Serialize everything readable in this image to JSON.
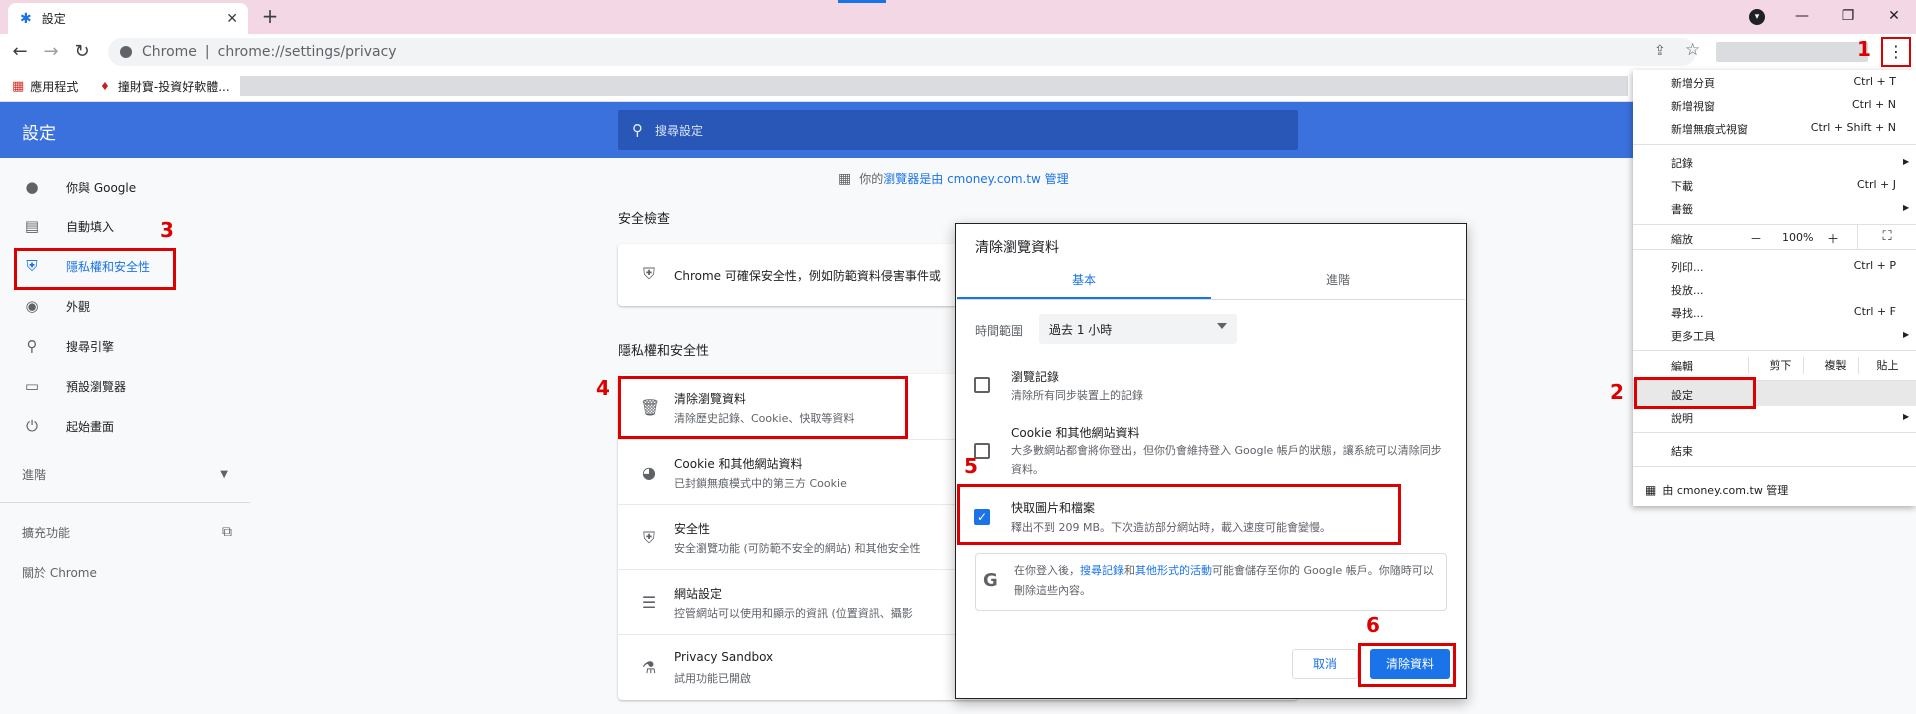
{
  "tab": {
    "title": "設定",
    "icon": "gear-icon",
    "close": "✕",
    "new_tab": "+"
  },
  "window": {
    "minimize": "—",
    "restore": "❐",
    "close": "✕"
  },
  "omnibox": {
    "scheme": "Chrome",
    "separator": "|",
    "url": "chrome://settings/privacy"
  },
  "bookmarks": {
    "apps": "應用程式",
    "site": "撞財寶-投資好軟體..."
  },
  "header": {
    "title": "設定",
    "search_placeholder": "搜尋設定"
  },
  "sidebar": {
    "items": [
      {
        "label": "你與 Google",
        "icon": "person-icon"
      },
      {
        "label": "自動填入",
        "icon": "clipboard-icon"
      },
      {
        "label": "隱私權和安全性",
        "icon": "shield-icon"
      },
      {
        "label": "外觀",
        "icon": "palette-icon"
      },
      {
        "label": "搜尋引擎",
        "icon": "search-icon"
      },
      {
        "label": "預設瀏覽器",
        "icon": "browser-icon"
      },
      {
        "label": "起始畫面",
        "icon": "power-icon"
      }
    ],
    "advanced": "進階",
    "extensions": "擴充功能",
    "about": "關於 Chrome"
  },
  "main": {
    "managed_prefix": "你的",
    "managed_link": "瀏覽器是由 cmoney.com.tw 管理",
    "safety_check_title": "安全檢查",
    "safety_check_text": "Chrome 可確保安全性，例如防範資料侵害事件或",
    "privacy_title": "隱私權和安全性",
    "rows": [
      {
        "title": "清除瀏覽資料",
        "sub": "清除歷史記錄、Cookie、快取等資料"
      },
      {
        "title": "Cookie 和其他網站資料",
        "sub": "已封鎖無痕模式中的第三方 Cookie"
      },
      {
        "title": "安全性",
        "sub": "安全瀏覽功能 (可防範不安全的網站) 和其他安全性"
      },
      {
        "title": "網站設定",
        "sub": "控管網站可以使用和顯示的資訊 (位置資訊、攝影"
      },
      {
        "title": "Privacy Sandbox",
        "sub": "試用功能已開啟"
      }
    ]
  },
  "dialog": {
    "title": "清除瀏覽資料",
    "tab_basic": "基本",
    "tab_advanced": "進階",
    "time_label": "時間範圍",
    "time_value": "過去 1 小時",
    "items": [
      {
        "title": "瀏覽記錄",
        "sub": "清除所有同步裝置上的記錄",
        "checked": false
      },
      {
        "title": "Cookie 和其他網站資料",
        "sub": "大多數網站都會將你登出，但你仍會維持登入 Google 帳戶的狀態，讓系統可以清除同步資料。",
        "checked": false
      },
      {
        "title": "快取圖片和檔案",
        "sub": "釋出不到 209 MB。下次造訪部分網站時，載入速度可能會變慢。",
        "checked": true
      }
    ],
    "google_note_1": "在你登入後，",
    "google_note_link1": "搜尋記錄",
    "google_note_2": "和",
    "google_note_link2": "其他形式的活動",
    "google_note_3": "可能會儲存至你的 Google 帳戶。你隨時可以刪除這些內容。",
    "cancel": "取消",
    "clear": "清除資料"
  },
  "menu": {
    "new_tab": "新增分頁",
    "new_tab_sc": "Ctrl + T",
    "new_window": "新增視窗",
    "new_window_sc": "Ctrl + N",
    "incognito": "新增無痕式視窗",
    "incognito_sc": "Ctrl + Shift + N",
    "history": "記錄",
    "downloads": "下載",
    "downloads_sc": "Ctrl + J",
    "bookmarks": "書籤",
    "zoom": "縮放",
    "zoom_minus": "－",
    "zoom_value": "100%",
    "zoom_plus": "＋",
    "print": "列印...",
    "print_sc": "Ctrl + P",
    "cast": "投放...",
    "find": "尋找...",
    "find_sc": "Ctrl + F",
    "more_tools": "更多工具",
    "edit": "編輯",
    "cut": "剪下",
    "copy": "複製",
    "paste": "貼上",
    "settings": "設定",
    "help": "說明",
    "exit": "結束",
    "managed": "由 cmoney.com.tw 管理"
  },
  "annotations": [
    "1",
    "2",
    "3",
    "4",
    "5",
    "6"
  ]
}
